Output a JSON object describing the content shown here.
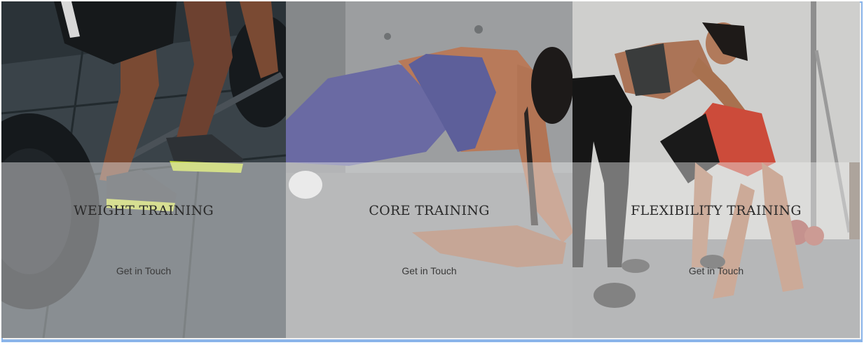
{
  "services": [
    {
      "title": "WEIGHT TRAINING",
      "cta": "Get in Touch",
      "image_icon": "weightlifting-photo"
    },
    {
      "title": "CORE TRAINING",
      "cta": "Get in Touch",
      "image_icon": "plank-photo"
    },
    {
      "title": "FLEXIBILITY TRAINING",
      "cta": "Get in Touch",
      "image_icon": "stretching-photo"
    }
  ],
  "colors": {
    "frame_border": "#8ab4ea",
    "overlay": "#ececec",
    "title_text": "#2a2a2a",
    "cta_text": "#3a3a3a"
  }
}
